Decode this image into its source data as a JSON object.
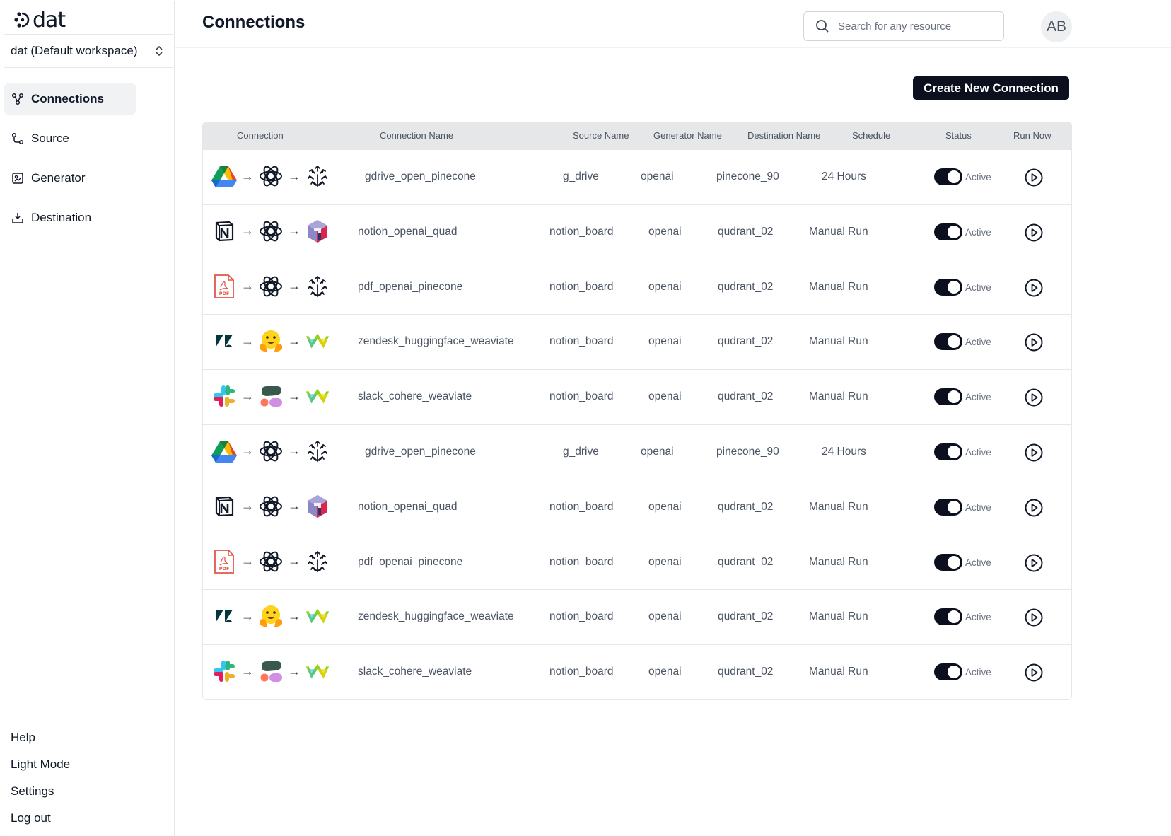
{
  "app": {
    "logo_text": "dat"
  },
  "workspace": {
    "label": "dat (Default workspace)"
  },
  "sidebar": {
    "items": [
      {
        "label": "Connections",
        "icon": "connections-icon",
        "active": true
      },
      {
        "label": "Source",
        "icon": "source-icon",
        "active": false
      },
      {
        "label": "Generator",
        "icon": "generator-icon",
        "active": false
      },
      {
        "label": "Destination",
        "icon": "destination-icon",
        "active": false
      }
    ],
    "bottom": [
      "Help",
      "Light Mode",
      "Settings",
      "Log out"
    ]
  },
  "header": {
    "title": "Connections",
    "search_placeholder": "Search for any resource",
    "avatar": "AB"
  },
  "actions": {
    "create_label": "Create New Connection"
  },
  "table": {
    "columns": [
      "Connection",
      "Connection Name",
      "Source Name",
      "Generator Name",
      "Destination Name",
      "Schedule",
      "Status",
      "Run Now"
    ],
    "rows": [
      {
        "icons": [
          "google-drive-icon",
          "openai-icon",
          "pinecone-icon"
        ],
        "name": "gdrive_open_pinecone",
        "source": "g_drive",
        "generator": "openai",
        "destination": "pinecone_90",
        "schedule": "24 Hours",
        "status": "Active"
      },
      {
        "icons": [
          "notion-icon",
          "openai-icon",
          "qdrant-icon"
        ],
        "name": "notion_openai_quad",
        "source": "notion_board",
        "generator": "openai",
        "destination": "qudrant_02",
        "schedule": "Manual Run",
        "status": "Active"
      },
      {
        "icons": [
          "pdf-icon",
          "openai-icon",
          "pinecone-icon"
        ],
        "name": "pdf_openai_pinecone",
        "source": "notion_board",
        "generator": "openai",
        "destination": "qudrant_02",
        "schedule": "Manual Run",
        "status": "Active"
      },
      {
        "icons": [
          "zendesk-icon",
          "huggingface-icon",
          "weaviate-icon"
        ],
        "name": "zendesk_huggingface_weaviate",
        "source": "notion_board",
        "generator": "openai",
        "destination": "qudrant_02",
        "schedule": "Manual Run",
        "status": "Active"
      },
      {
        "icons": [
          "slack-icon",
          "cohere-icon",
          "weaviate-icon"
        ],
        "name": "slack_cohere_weaviate",
        "source": "notion_board",
        "generator": "openai",
        "destination": "qudrant_02",
        "schedule": "Manual Run",
        "status": "Active"
      },
      {
        "icons": [
          "google-drive-icon",
          "openai-icon",
          "pinecone-icon"
        ],
        "name": "gdrive_open_pinecone",
        "source": "g_drive",
        "generator": "openai",
        "destination": "pinecone_90",
        "schedule": "24 Hours",
        "status": "Active"
      },
      {
        "icons": [
          "notion-icon",
          "openai-icon",
          "qdrant-icon"
        ],
        "name": "notion_openai_quad",
        "source": "notion_board",
        "generator": "openai",
        "destination": "qudrant_02",
        "schedule": "Manual Run",
        "status": "Active"
      },
      {
        "icons": [
          "pdf-icon",
          "openai-icon",
          "pinecone-icon"
        ],
        "name": "pdf_openai_pinecone",
        "source": "notion_board",
        "generator": "openai",
        "destination": "qudrant_02",
        "schedule": "Manual Run",
        "status": "Active"
      },
      {
        "icons": [
          "zendesk-icon",
          "huggingface-icon",
          "weaviate-icon"
        ],
        "name": "zendesk_huggingface_weaviate",
        "source": "notion_board",
        "generator": "openai",
        "destination": "qudrant_02",
        "schedule": "Manual Run",
        "status": "Active"
      },
      {
        "icons": [
          "slack-icon",
          "cohere-icon",
          "weaviate-icon"
        ],
        "name": "slack_cohere_weaviate",
        "source": "notion_board",
        "generator": "openai",
        "destination": "qudrant_02",
        "schedule": "Manual Run",
        "status": "Active"
      }
    ]
  },
  "colors": {
    "accent": "#0b0f1e",
    "header_bg": "#e6e7e9",
    "active_nav_bg": "#f1f2f4"
  }
}
